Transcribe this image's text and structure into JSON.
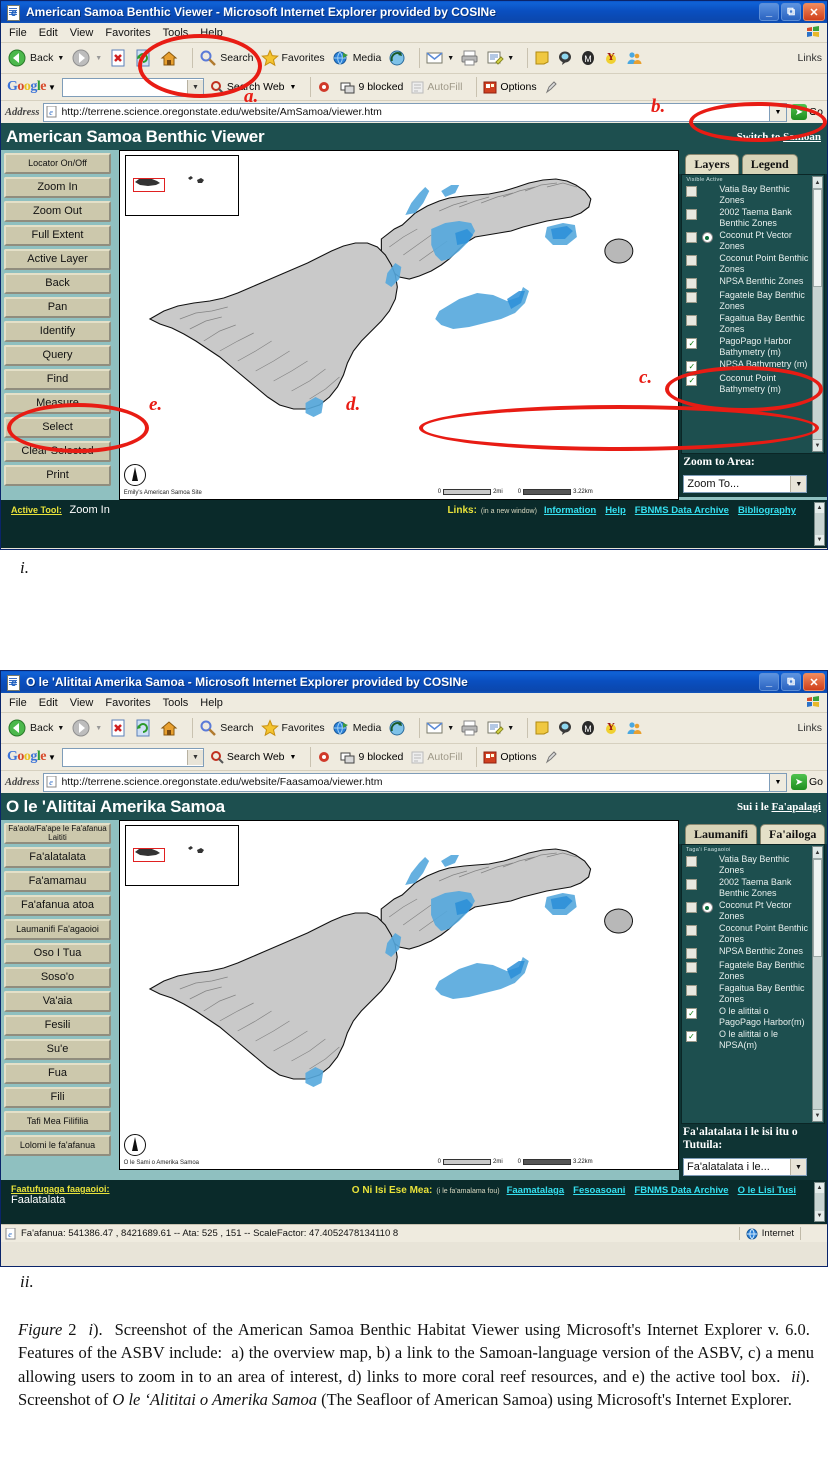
{
  "figure": {
    "label_i": "i.",
    "label_ii": "ii.",
    "caption_html": "Figure 2  i).  Screenshot of the American Samoa Benthic Habitat Viewer using Microsoft's Internet Explorer v. 6.0.  Features of the ASBV include:  a) the overview map, b) a link to the Samoan-language version of the ASBV, c) a menu allowing users to zoom in to an area of interest, d) links to more coral reef resources, and e) the active tool box.  ii).  Screenshot of O le 'Alititai o Amerika Samoa (The Seafloor of American Samoa) using Microsoft's Internet Explorer."
  },
  "annotations": [
    {
      "key": "a",
      "label": "a."
    },
    {
      "key": "b",
      "label": "b."
    },
    {
      "key": "c",
      "label": "c."
    },
    {
      "key": "d",
      "label": "d."
    },
    {
      "key": "e",
      "label": "e."
    }
  ],
  "browser_chrome": {
    "menu": [
      "File",
      "Edit",
      "View",
      "Favorites",
      "Tools",
      "Help"
    ],
    "toolbar": {
      "back": "Back",
      "forward": "",
      "stop": "stop-icon",
      "refresh": "refresh-icon",
      "home": "home-icon",
      "search": "Search",
      "favorites": "Favorites",
      "media": "Media",
      "history": "history-icon",
      "mail": "mail-icon",
      "print": "print-icon",
      "edit": "edit-icon",
      "links_label": "Links"
    },
    "google_bar": {
      "logo": "Google",
      "search_value": "",
      "search_web": "Search Web",
      "blocked": "9 blocked",
      "autofill": "AutoFill",
      "options": "Options"
    },
    "address_label": "Address",
    "go_label": "Go"
  },
  "window_one": {
    "title": "American Samoa Benthic Viewer - Microsoft Internet Explorer provided by COSINe",
    "url": "http://terrene.science.oregonstate.edu/website/AmSamoa/viewer.htm",
    "app_title": "American Samoa Benthic Viewer",
    "switch_prefix": "Switch to ",
    "switch_link": "Samoan",
    "tools": [
      "Locator On/Off",
      "Zoom In",
      "Zoom Out",
      "Full Extent",
      "Active Layer",
      "Back",
      "Pan",
      "Identify",
      "Query",
      "Find",
      "Measure",
      "Select",
      "Clear Selected",
      "Print"
    ],
    "tabs": [
      {
        "label": "Layers",
        "active": true
      },
      {
        "label": "Legend",
        "active": false
      }
    ],
    "visible_active_header": "Visible Active",
    "layers": [
      {
        "name": "Vatia Bay Benthic Zones",
        "visible": false,
        "active": false
      },
      {
        "name": "2002 Taema Bank Benthic Zones",
        "visible": false,
        "active": false
      },
      {
        "name": "Coconut Pt Vector Zones",
        "visible": false,
        "active": true
      },
      {
        "name": "Coconut Point Benthic Zones",
        "visible": false,
        "active": false
      },
      {
        "name": "NPSA Benthic Zones",
        "visible": false,
        "active": false
      },
      {
        "name": "Fagatele Bay Benthic Zones",
        "visible": false,
        "active": false
      },
      {
        "name": "Fagaitua Bay Benthic Zones",
        "visible": false,
        "active": false
      },
      {
        "name": "PagoPago Harbor Bathymetry (m)",
        "visible": true,
        "active": false
      },
      {
        "name": "NPSA Bathymetry (m)",
        "visible": true,
        "active": false
      },
      {
        "name": "Coconut Point Bathymetry (m)",
        "visible": true,
        "active": false
      }
    ],
    "zoom_to_area_label": "Zoom to Area:",
    "zoom_select_value": "Zoom To...",
    "map_credit": "Emily's American Samoa Site",
    "scale_bars": [
      {
        "min": "0",
        "max": "2mi"
      },
      {
        "min": "0",
        "max": "3.22km"
      }
    ],
    "footer": {
      "active_tool_label": "Active Tool:",
      "active_tool_value": "Zoom In",
      "links_label": "Links:",
      "links_note": "(in a new window)",
      "links": [
        "Information",
        "Help",
        "FBNMS Data Archive",
        "Bibliography"
      ]
    }
  },
  "window_two": {
    "title": "O le 'Alititai Amerika Samoa - Microsoft Internet Explorer provided by COSINe",
    "url": "http://terrene.science.oregonstate.edu/website/Faasamoa/viewer.htm",
    "app_title": "O le 'Alititai Amerika Samoa",
    "switch_prefix": "Sui i le ",
    "switch_link": "Fa'apalagi",
    "tools": [
      "Fa'aola/Fa'ape le Fa'afanua Laititi",
      "Fa'alatalata",
      "Fa'amamau",
      "Fa'afanua atoa",
      "Laumanifi Fa'agaoioi",
      "Oso I Tua",
      "Soso'o",
      "Va'aia",
      "Fesili",
      "Su'e",
      "Fua",
      "Fili",
      "Tafi Mea Filifilia",
      "Lolomi le fa'afanua"
    ],
    "tabs": [
      {
        "label": "Laumanifi",
        "active": false
      },
      {
        "label": "Fa'ailoga",
        "active": true
      }
    ],
    "visible_active_header": "Taga'i Faagaoioi",
    "layers": [
      {
        "name": "Vatia Bay Benthic Zones",
        "visible": false,
        "active": false
      },
      {
        "name": "2002 Taema Bank Benthic Zones",
        "visible": false,
        "active": false
      },
      {
        "name": "Coconut Pt Vector Zones",
        "visible": false,
        "active": true
      },
      {
        "name": "Coconut Point Benthic Zones",
        "visible": false,
        "active": false
      },
      {
        "name": "NPSA Benthic Zones",
        "visible": false,
        "active": false
      },
      {
        "name": "Fagatele Bay Benthic Zones",
        "visible": false,
        "active": false
      },
      {
        "name": "Fagaitua Bay Benthic Zones",
        "visible": false,
        "active": false
      },
      {
        "name": "O le alititai o PagoPago Harbor(m)",
        "visible": true,
        "active": false
      },
      {
        "name": "O le alititai o le NPSA(m)",
        "visible": true,
        "active": false
      }
    ],
    "zoom_to_area_label": "Fa'alatalata i le isi itu o Tutuila:",
    "zoom_select_value": "Fa'alatalata i le...",
    "map_credit": "O le Sami o Amerika Samoa",
    "scale_bars": [
      {
        "min": "0",
        "max": "2mi"
      },
      {
        "min": "0",
        "max": "3.22km"
      }
    ],
    "footer": {
      "active_tool_label": "Faatufugaga faagaoioi:",
      "active_tool_value": "Faalatalata",
      "links_label": "O Ni Isi Ese Mea:",
      "links_note": "(i le fa'amalama fou)",
      "links": [
        "Faamatalaga",
        "Fesoasoani",
        "FBNMS Data Archive",
        "O le Lisi Tusi"
      ]
    },
    "statusbar": {
      "coords": "Fa'afanua: 541386.47 , 8421689.61 -- Ata: 525 , 151 -- ScaleFactor: 47.4052478134110 8",
      "zone": "Internet"
    }
  },
  "colors": {
    "app_header": "#1d4f4f",
    "panel_dark": "#0f3434",
    "footer_dark": "#0a2a2a",
    "tool_col": "#8fc0c0",
    "button_face": "#ccc8ac",
    "link_cyan": "#35e0f0",
    "accent_yellow": "#e8e23a",
    "annotation_red": "#e81c14",
    "title_blue": "#0b47ad"
  }
}
